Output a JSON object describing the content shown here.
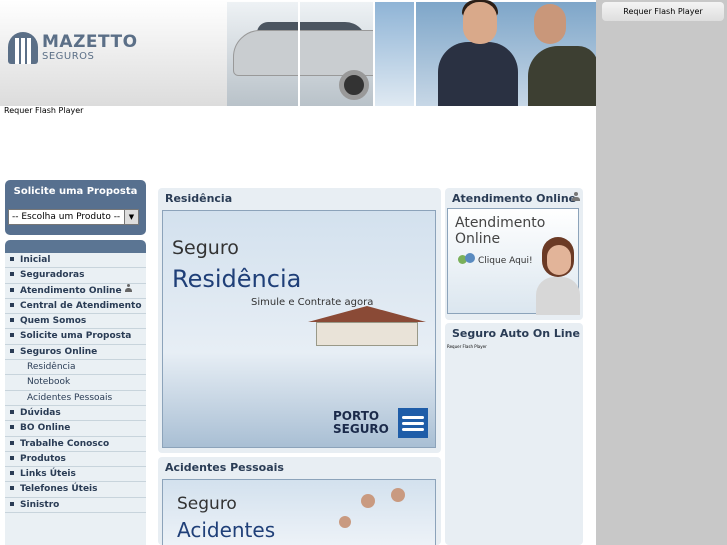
{
  "header": {
    "logo": {
      "line1": "MAZETTO",
      "line2": "SEGUROS"
    },
    "flash_notice": "Requer Flash Player"
  },
  "side_right": {
    "flash_notice": "Requer Flash Player"
  },
  "solicite": {
    "title": "Solicite uma Proposta",
    "select_value": "-- Escolha um Produto --"
  },
  "menu": {
    "items": [
      {
        "label": "Inicial",
        "sub": false
      },
      {
        "label": "Seguradoras",
        "sub": false
      },
      {
        "label": "Atendimento Online",
        "sub": false,
        "icon": "person-icon"
      },
      {
        "label": "Central de Atendimento",
        "sub": false
      },
      {
        "label": "Quem Somos",
        "sub": false
      },
      {
        "label": "Solicite uma Proposta",
        "sub": false
      },
      {
        "label": "Seguros Online",
        "sub": false
      },
      {
        "label": "Residência",
        "sub": true
      },
      {
        "label": "Notebook",
        "sub": true
      },
      {
        "label": "Acidentes Pessoais",
        "sub": true
      },
      {
        "label": "Dúvidas",
        "sub": false
      },
      {
        "label": "BO Online",
        "sub": false
      },
      {
        "label": "Trabalhe Conosco",
        "sub": false
      },
      {
        "label": "Produtos",
        "sub": false
      },
      {
        "label": "Links Úteis",
        "sub": false
      },
      {
        "label": "Telefones Úteis",
        "sub": false
      },
      {
        "label": "Sinistro",
        "sub": false
      }
    ]
  },
  "residencia": {
    "title": "Residência",
    "banner": {
      "line1": "Seguro",
      "line2": "Residência",
      "line3": "Simule e Contrate agora",
      "brand": "PORTO\nSEGURO"
    }
  },
  "acidentes": {
    "title": "Acidentes Pessoais",
    "banner": {
      "line1": "Seguro",
      "line2": "Acidentes"
    }
  },
  "atendimento": {
    "title": "Atendimento Online",
    "banner": {
      "line1": "Atendimento",
      "line2": "Online",
      "cta": "Clique Aqui!"
    }
  },
  "auto": {
    "title": "Seguro Auto On Line",
    "flash_notice": "Requer Flash Player"
  },
  "colors": {
    "accent": "#57708f",
    "menu_text": "#2a3c55",
    "page_bg": "#c8c8c8"
  }
}
